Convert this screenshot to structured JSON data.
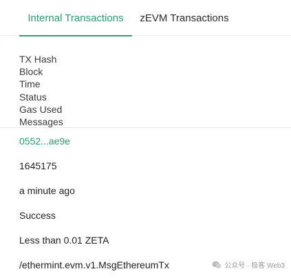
{
  "tabs": [
    {
      "label": "Internal Transactions",
      "active": true
    },
    {
      "label": "zEVM Transactions",
      "active": false
    }
  ],
  "table": {
    "headers": [
      "TX Hash",
      "Block",
      "Time",
      "Status",
      "Gas Used",
      "Messages"
    ],
    "row": {
      "tx_hash": "0552...ae9e",
      "block": "1645175",
      "time": "a minute ago",
      "status": "Success",
      "gas_used": "Less than 0.01 ZETA",
      "messages": "/ethermint.evm.v1.MsgEthereumTx"
    }
  },
  "watermark": {
    "icon": "wechat-icon",
    "text": "公众号 · 极客 Web3"
  },
  "colors": {
    "accent": "#2e9b72"
  }
}
